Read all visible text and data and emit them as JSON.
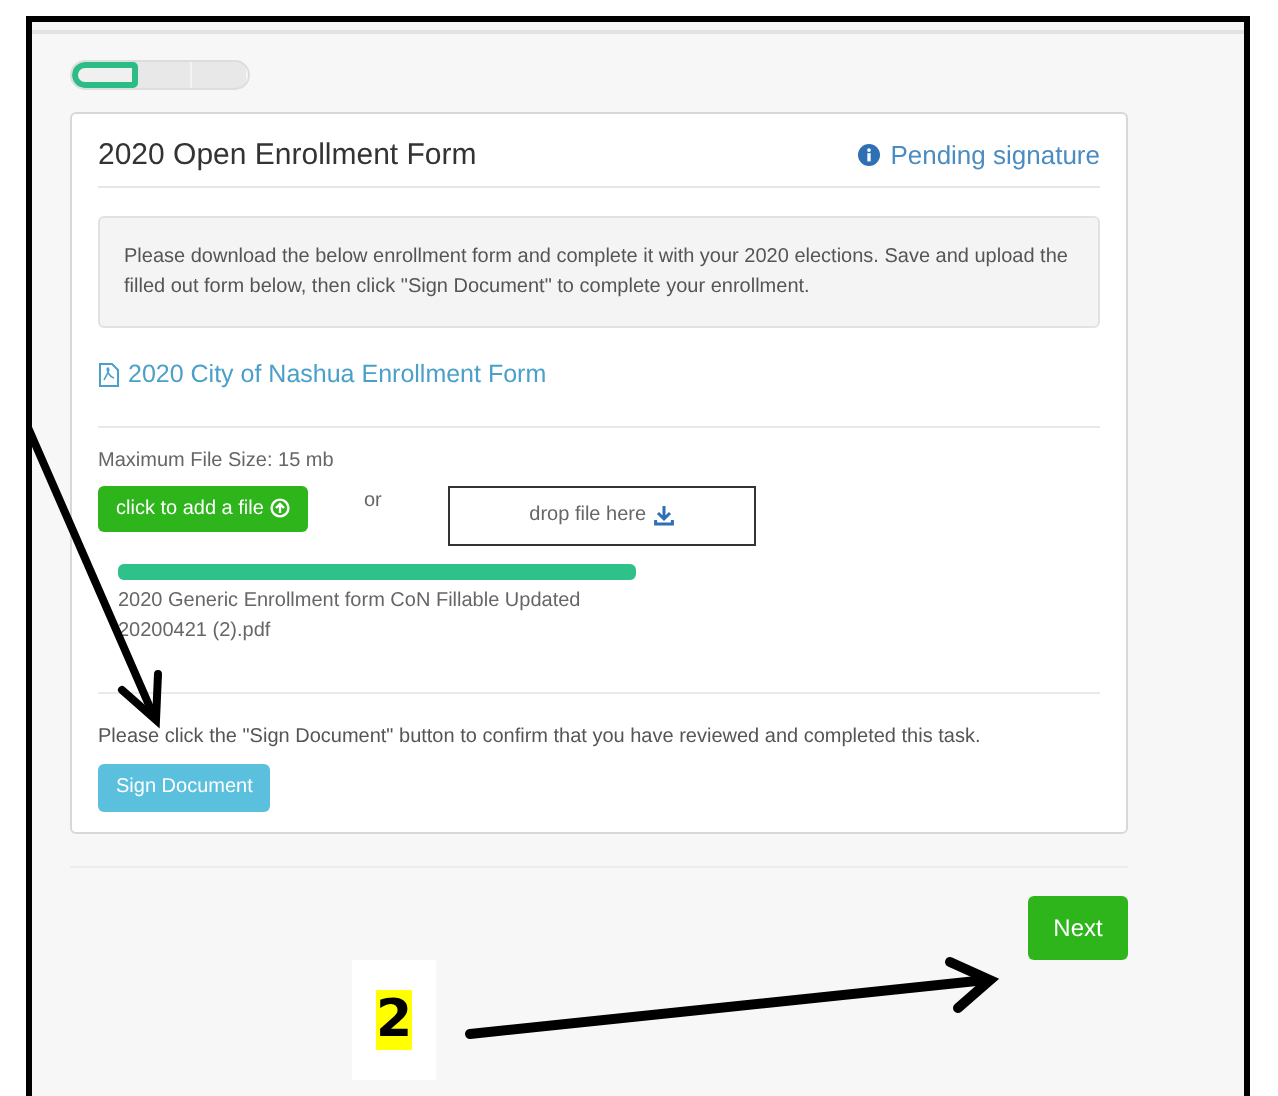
{
  "steps": [
    {
      "selected": true
    },
    {
      "selected": false
    },
    {
      "selected": false
    }
  ],
  "card": {
    "title": "2020 Open Enrollment Form",
    "status": "Pending signature",
    "instructions": "Please download the below enrollment form and complete it with your 2020 elections. Save and upload the filled out form below, then click \"Sign Document\" to complete your enrollment.",
    "form_link": "2020 City of Nashua Enrollment Form",
    "max_size": "Maximum File Size: 15 mb",
    "add_button": "click to add a file",
    "or": "or",
    "drop_zone": "drop file here",
    "upload": {
      "level": 1,
      "file_name": "2020 Generic Enrollment form CoN Fillable Updated 20200421 (2).pdf"
    },
    "confirm_text": "Please click the \"Sign Document\" button to confirm that you have reviewed and completed this task.",
    "sign_button": "Sign Document"
  },
  "next_button": "Next",
  "annotation": {
    "label": "2"
  }
}
